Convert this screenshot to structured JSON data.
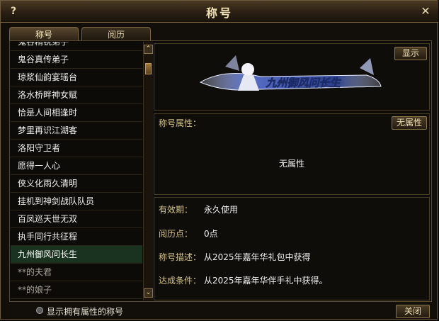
{
  "window": {
    "title": "称号",
    "help_label": "?",
    "close_label": "✕"
  },
  "tabs": [
    {
      "label": "称号"
    },
    {
      "label": "阅历"
    }
  ],
  "titles_list": [
    {
      "label": "鬼谷精锐弟子"
    },
    {
      "label": "鬼谷真传弟子"
    },
    {
      "label": "琼浆仙韵宴瑶台"
    },
    {
      "label": "洛水桥畔神女赋"
    },
    {
      "label": "恰是人间相逢时"
    },
    {
      "label": "梦里再识江湖客"
    },
    {
      "label": "洛阳守卫者"
    },
    {
      "label": "愿得一人心"
    },
    {
      "label": "侠义化雨久清明"
    },
    {
      "label": "挂机到神剑战队队员"
    },
    {
      "label": "百凤巡天世无双"
    },
    {
      "label": "执手同行共征程"
    },
    {
      "label": "九州御风问长生"
    },
    {
      "label": "**的夫君"
    },
    {
      "label": "**的娘子"
    }
  ],
  "selected_title": "九州御风问长生",
  "scrollbar": {
    "up": "⌃",
    "down": "⌄"
  },
  "display_button": "显示",
  "banner_text": "九州御风问长生",
  "attributes": {
    "label": "称号属性：",
    "button": "无属性",
    "value": "无属性"
  },
  "details": {
    "validity_label": "有效期：",
    "validity_value": "永久使用",
    "exp_label": "阅历点：",
    "exp_value": "0点",
    "desc_label": "称号描述：",
    "desc_value": "从2025年嘉年华礼包中获得",
    "cond_label": "达成条件：",
    "cond_value": "从2025年嘉年华伴手礼中获得。"
  },
  "bottom": {
    "filter_label": "显示拥有属性的称号",
    "close_button": "关闭"
  },
  "colors": {
    "accent": "#d6c486",
    "selected_row": "#1a3320",
    "banner_bg": "#2a3f8f"
  }
}
